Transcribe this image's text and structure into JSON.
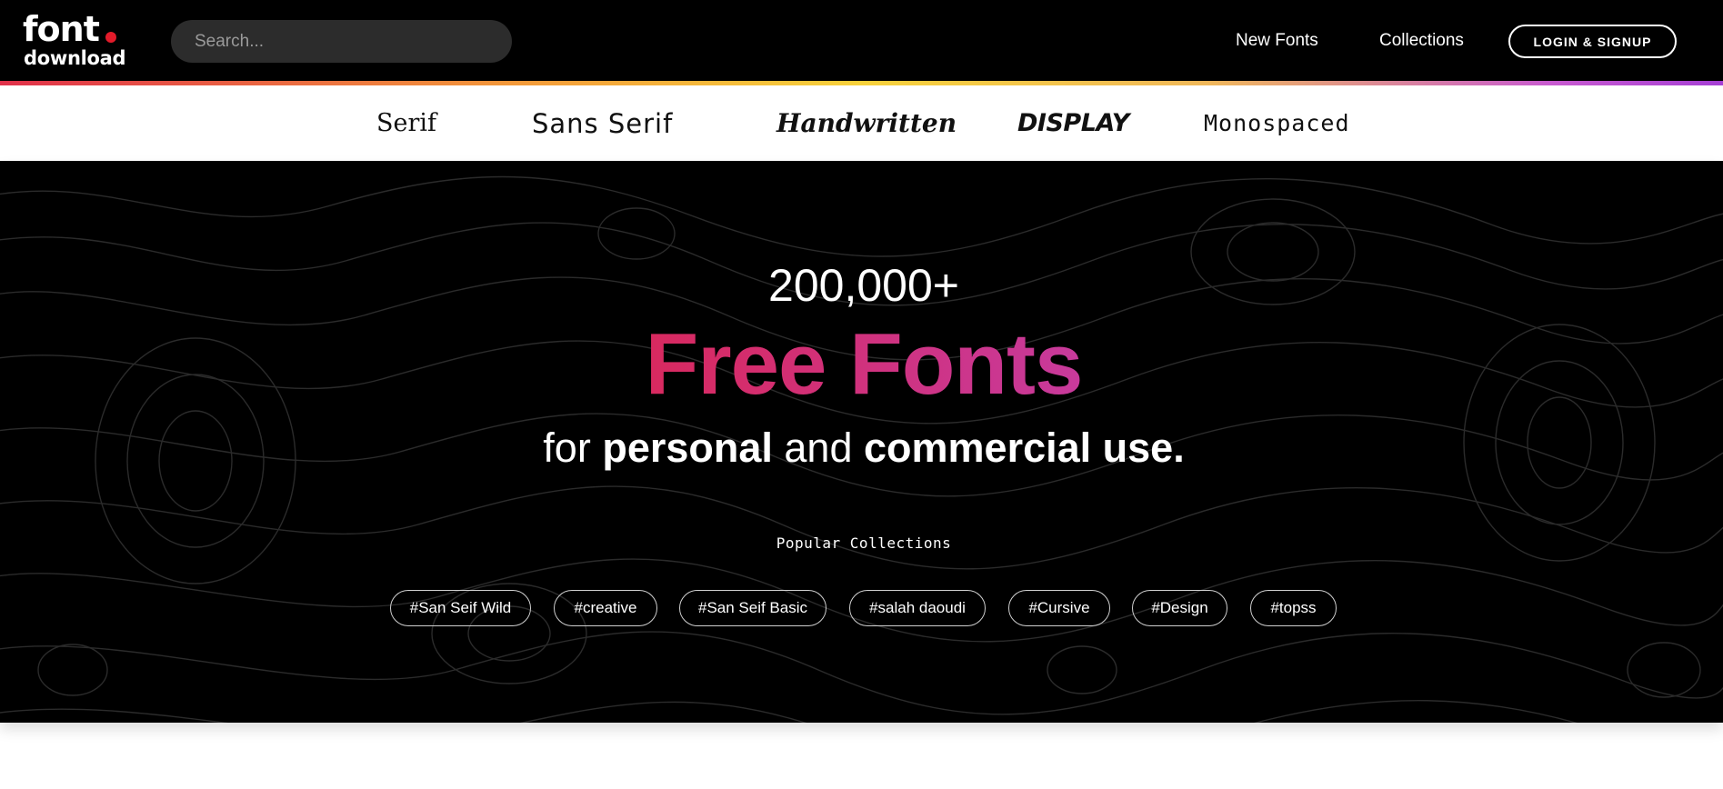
{
  "header": {
    "logo_top": "font",
    "logo_bottom": "download",
    "search_placeholder": "Search...",
    "nav": [
      {
        "label": "New Fonts"
      },
      {
        "label": "Collections"
      }
    ],
    "login_label": "LOGIN & SIGNUP"
  },
  "categories": [
    {
      "label": "Serif"
    },
    {
      "label": "Sans Serif"
    },
    {
      "label": "Handwritten"
    },
    {
      "label": "DISPLAY"
    },
    {
      "label": "Monospaced"
    }
  ],
  "hero": {
    "count": "200,000+",
    "title": "Free Fonts",
    "sub_for": "for",
    "sub_personal": "personal",
    "sub_and": "and",
    "sub_commercial": "commercial use.",
    "popular_label": "Popular Collections",
    "tags": [
      "#San Seif Wild",
      "#creative",
      "#San Seif Basic",
      "#salah daoudi",
      "#Cursive",
      "#Design",
      "#topss"
    ]
  },
  "colors": {
    "logo_dot": "#e21b2a",
    "title_gradient_start": "#d8295f",
    "title_gradient_end": "#c83a9c",
    "background": "#000000"
  }
}
